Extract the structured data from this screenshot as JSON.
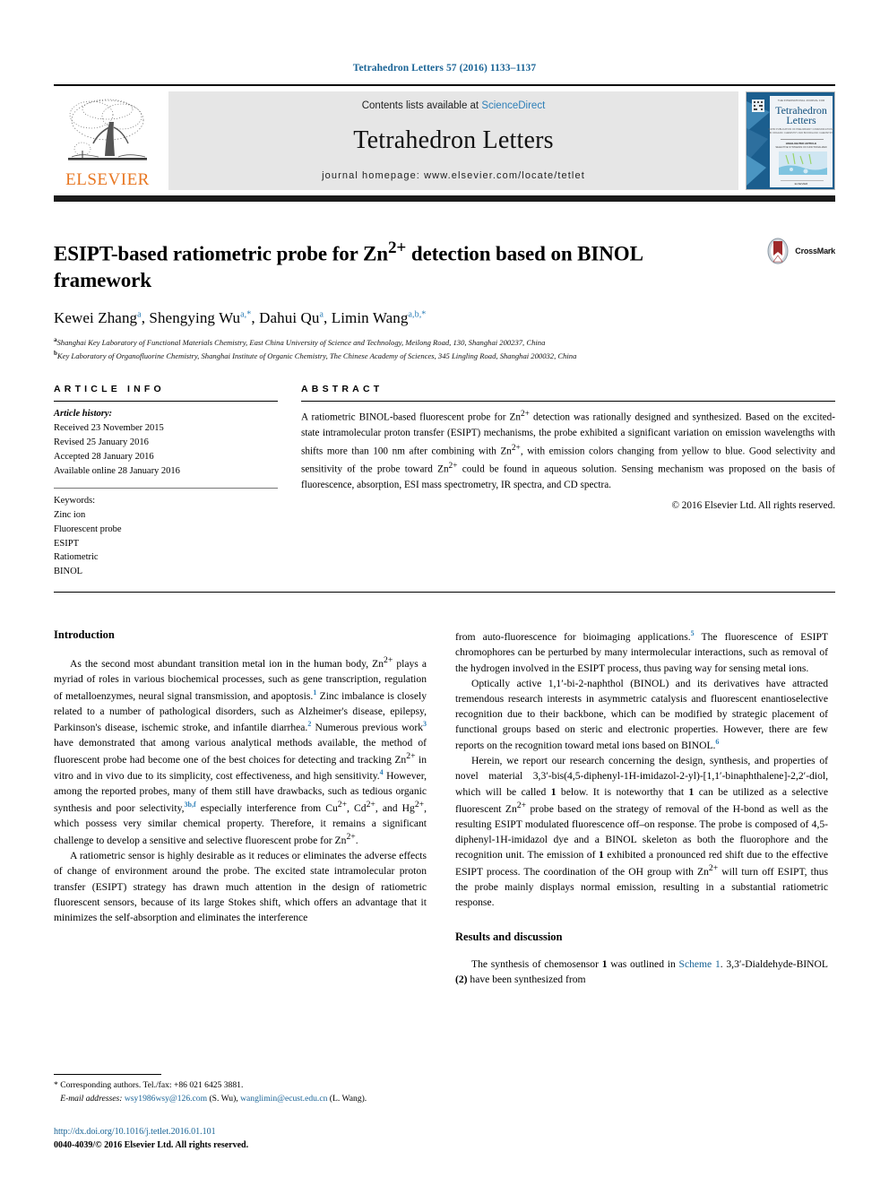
{
  "running_head": "Tetrahedron Letters 57 (2016) 1133–1137",
  "masthead": {
    "contents_prefix": "Contents lists available at ",
    "sciencedirect": "ScienceDirect",
    "journal_title": "Tetrahedron Letters",
    "homepage": "journal homepage: www.elsevier.com/locate/tetlet",
    "publisher_wordmark": "ELSEVIER",
    "cover_title_line1": "Tetrahedron",
    "cover_title_line2": "Letters"
  },
  "title": {
    "line": "ESIPT-based ratiometric probe for Zn2+ detection based on BINOL framework",
    "part1": "ESIPT-based ratiometric probe for Zn",
    "sup": "2+",
    "part2": " detection based on BINOL framework",
    "crossmark_label": "CrossMark"
  },
  "authors": [
    {
      "name": "Kewei Zhang",
      "marks": "a"
    },
    {
      "name": "Shengying Wu",
      "marks": "a,*"
    },
    {
      "name": "Dahui Qu",
      "marks": "a"
    },
    {
      "name": "Limin Wang",
      "marks": "a,b,*"
    }
  ],
  "affiliations": [
    {
      "mark": "a",
      "text": "Shanghai Key Laboratory of Functional Materials Chemistry, East China University of Science and Technology, Meilong Road, 130, Shanghai 200237, China"
    },
    {
      "mark": "b",
      "text": "Key Laboratory of Organofluorine Chemistry, Shanghai Institute of Organic Chemistry, The Chinese Academy of Sciences, 345 Lingling Road, Shanghai 200032, China"
    }
  ],
  "article_info": {
    "heading": "ARTICLE INFO",
    "history_label": "Article history:",
    "history": [
      "Received 23 November 2015",
      "Revised 25 January 2016",
      "Accepted 28 January 2016",
      "Available online 28 January 2016"
    ],
    "keywords_label": "Keywords:",
    "keywords": [
      "Zinc ion",
      "Fluorescent probe",
      "ESIPT",
      "Ratiometric",
      "BINOL"
    ]
  },
  "abstract": {
    "heading": "ABSTRACT",
    "p1_a": "A ratiometric BINOL-based fluorescent probe for Zn",
    "p1_sup1": "2+",
    "p1_b": " detection was rationally designed and synthesized. Based on the excited-state intramolecular proton transfer (ESIPT) mechanisms, the probe exhibited a significant variation on emission wavelengths with shifts more than 100 nm after combining with Zn",
    "p1_sup2": "2+",
    "p1_c": ", with emission colors changing from yellow to blue. Good selectivity and sensitivity of the probe toward Zn",
    "p1_sup3": "2+",
    "p1_d": " could be found in aqueous solution. Sensing mechanism was proposed on the basis of fluorescence, absorption, ESI mass spectrometry, IR spectra, and CD spectra.",
    "copyright": "© 2016 Elsevier Ltd. All rights reserved."
  },
  "sections": {
    "introduction_heading": "Introduction",
    "results_heading": "Results and discussion"
  },
  "left_column": {
    "p1_a": "As the second most abundant transition metal ion in the human body, Zn",
    "p1_sup1": "2+",
    "p1_b": " plays a myriad of roles in various biochemical processes, such as gene transcription, regulation of metalloenzymes, neural signal transmission, and apoptosis.",
    "p1_ref1": "1",
    "p1_c": " Zinc imbalance is closely related to a number of pathological disorders, such as Alzheimer's disease, epilepsy, Parkinson's disease, ischemic stroke, and infantile diarrhea.",
    "p1_ref2": "2",
    "p1_d": " Numerous previous work",
    "p1_ref3": "3",
    "p1_e": " have demonstrated that among various analytical methods available, the method of fluorescent probe had become one of the best choices for detecting and tracking Zn",
    "p1_sup2": "2+",
    "p1_f": " in vitro and in vivo due to its simplicity, cost effectiveness, and high sensitivity.",
    "p1_ref4": "4",
    "p1_g": " However, among the reported probes, many of them still have drawbacks, such as tedious organic synthesis and poor selectivity,",
    "p1_ref5": "3b,f",
    "p1_h": " especially interference from Cu",
    "p1_sup3": "2+",
    "p1_i": ", Cd",
    "p1_sup4": "2+",
    "p1_j": ", and Hg",
    "p1_sup5": "2+",
    "p1_k": ", which possess very similar chemical property. Therefore, it remains a significant challenge to develop a sensitive and selective fluorescent probe for Zn",
    "p1_sup6": "2+",
    "p1_l": ".",
    "p2": "A ratiometric sensor is highly desirable as it reduces or eliminates the adverse effects of change of environment around the probe. The excited state intramolecular proton transfer (ESIPT) strategy has drawn much attention in the design of ratiometric fluorescent sensors, because of its large Stokes shift, which offers an advantage that it minimizes the self-absorption and eliminates the interference"
  },
  "right_column": {
    "p1_a": "from auto-fluorescence for bioimaging applications.",
    "p1_ref": "5",
    "p1_b": " The fluorescence of ESIPT chromophores can be perturbed by many intermolecular interactions, such as removal of the hydrogen involved in the ESIPT process, thus paving way for sensing metal ions.",
    "p2_a": "Optically active 1,1′-bi-2-naphthol (BINOL) and its derivatives have attracted tremendous research interests in asymmetric catalysis and fluorescent enantioselective recognition due to their backbone, which can be modified by strategic placement of functional groups based on steric and electronic properties. However, there are few reports on the recognition toward metal ions based on BINOL.",
    "p2_ref": "6",
    "p3_a": "Herein, we report our research concerning the design, synthesis, and properties of novel material 3,3′-bis(4,5-diphenyl-1H-imidazol-2-yl)-[1,1′-binaphthalene]-2,2′-diol, which will be called ",
    "p3_b1": "1",
    "p3_c": " below. It is noteworthy that ",
    "p3_b2": "1",
    "p3_d": " can be utilized as a selective fluorescent Zn",
    "p3_sup1": "2+",
    "p3_e": " probe based on the strategy of removal of the H-bond as well as the resulting ESIPT modulated fluorescence off–on response. The probe is composed of 4,5-diphenyl-1H-imidazol dye and a BINOL skeleton as both the fluorophore and the recognition unit. The emission of ",
    "p3_b3": "1",
    "p3_f": " exhibited a pronounced red shift due to the effective ESIPT process. The coordination of the OH group with Zn",
    "p3_sup2": "2+",
    "p3_g": " will turn off ESIPT, thus the probe mainly displays normal emission, resulting in a substantial ratiometric response.",
    "p4_a": "The synthesis of chemosensor ",
    "p4_b1": "1",
    "p4_c": " was outlined in ",
    "p4_link": "Scheme 1",
    "p4_d": ". 3,3′-Dialdehyde-BINOL ",
    "p4_b2": "(2)",
    "p4_e": " have been synthesized from"
  },
  "footnotes": {
    "corresponding": "* Corresponding authors. Tel./fax: +86 021 6425 3881.",
    "email_label": "E-mail addresses:",
    "email1": "wsy1986wsy@126.com",
    "email1_owner": "(S. Wu),",
    "email2": "wanglimin@ecust.edu.cn",
    "email2_owner": "(L. Wang).",
    "doi": "http://dx.doi.org/10.1016/j.tetlet.2016.01.101",
    "issn": "0040-4039/© 2016 Elsevier Ltd. All rights reserved."
  },
  "colors": {
    "link_blue": "#1a6496",
    "sciencedirect_blue": "#2d7fb8",
    "elsevier_orange": "#E87722",
    "masthead_grey": "#e6e6e6",
    "crossmark_red": "#9e2a2b"
  }
}
